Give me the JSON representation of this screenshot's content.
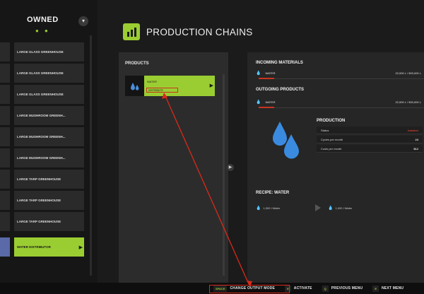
{
  "sidebar": {
    "title": "OWNED",
    "items": [
      {
        "label": "LARGE GLASS GREENHOUSE"
      },
      {
        "label": "LARGE GLASS GREENHOUSE"
      },
      {
        "label": "LARGE GLASS GREENHOUSE"
      },
      {
        "label": "LARGE MUSHROOM GREENH..."
      },
      {
        "label": "LARGE MUSHROOM GREENH..."
      },
      {
        "label": "LARGE MUSHROOM GREENH..."
      },
      {
        "label": "LARGE TARP GREENHOUSE"
      },
      {
        "label": "LARGE TARP GREENHOUSE"
      },
      {
        "label": "LARGE TARP GREENHOUSE"
      },
      {
        "label": "WATER DISTRIBUTOR"
      }
    ]
  },
  "header": {
    "title": "PRODUCTION CHAINS"
  },
  "products": {
    "label": "PRODUCTS",
    "card": {
      "name": "WATER",
      "mode": "DISTRIBUTE"
    }
  },
  "incoming": {
    "title": "INCOMING MATERIALS",
    "item": {
      "name": "WATER",
      "value": "22,000 L / 500,000 L"
    }
  },
  "outgoing": {
    "title": "OUTGOING PRODUCTS",
    "item": {
      "name": "WATER",
      "value": "22,000 L / 500,000 L"
    }
  },
  "production": {
    "title": "PRODUCTION",
    "rows": [
      {
        "label": "Status",
        "value": "Inactive"
      },
      {
        "label": "Cycles per month",
        "value": "24"
      },
      {
        "label": "Costs per month",
        "value": "$12"
      }
    ]
  },
  "recipe": {
    "title": "RECIPE: WATER",
    "input": "1,000 l Water",
    "output": "1,000 l Water"
  },
  "bottom_bar": {
    "items": [
      {
        "key": "SPACE",
        "label": "CHANGE OUTPUT MODE"
      },
      {
        "key": "E",
        "label": "ACTIVATE"
      },
      {
        "key": "Q",
        "label": "PREVIOUS MENU"
      },
      {
        "key": "E",
        "label": "NEXT MENU"
      }
    ]
  },
  "colors": {
    "accent": "#9acd32",
    "highlight": "#d92a1a",
    "background": "#1b1b1b"
  }
}
